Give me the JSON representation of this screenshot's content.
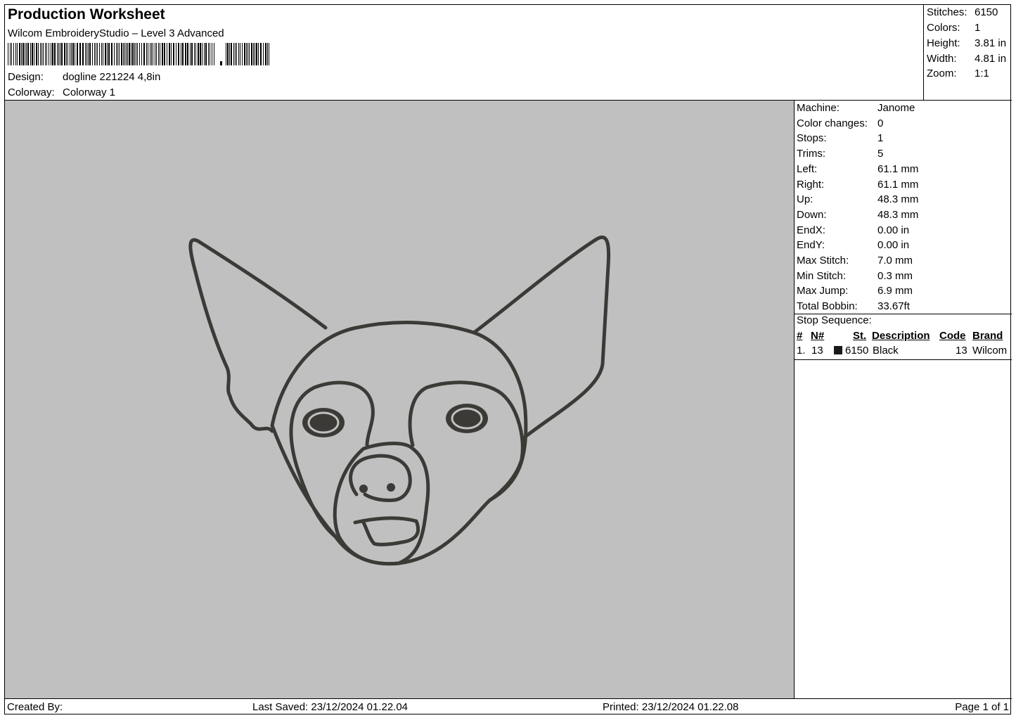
{
  "header": {
    "title": "Production Worksheet",
    "software": "Wilcom EmbroideryStudio – Level 3 Advanced",
    "design_label": "Design:",
    "design_value": "dogline 221224 4,8in",
    "colorway_label": "Colorway:",
    "colorway_value": "Colorway 1"
  },
  "summary": {
    "stitches_label": "Stitches:",
    "stitches": "6150",
    "colors_label": "Colors:",
    "colors": "1",
    "height_label": "Height:",
    "height": "3.81 in",
    "width_label": "Width:",
    "width": "4.81 in",
    "zoom_label": "Zoom:",
    "zoom": "1:1"
  },
  "machine_info": [
    {
      "label": "Machine:",
      "value": "Janome"
    },
    {
      "label": "Color changes:",
      "value": "0"
    },
    {
      "label": "Stops:",
      "value": "1"
    },
    {
      "label": "Trims:",
      "value": "5"
    },
    {
      "label": "Left:",
      "value": "61.1 mm"
    },
    {
      "label": "Right:",
      "value": "61.1 mm"
    },
    {
      "label": "Up:",
      "value": "48.3 mm"
    },
    {
      "label": "Down:",
      "value": "48.3 mm"
    },
    {
      "label": "EndX:",
      "value": "0.00 in"
    },
    {
      "label": "EndY:",
      "value": "0.00 in"
    },
    {
      "label": "Max Stitch:",
      "value": "7.0 mm"
    },
    {
      "label": "Min Stitch:",
      "value": "0.3 mm"
    },
    {
      "label": "Max Jump:",
      "value": "6.9 mm"
    },
    {
      "label": "Total Bobbin:",
      "value": "33.67ft"
    }
  ],
  "stop_sequence": {
    "title": "Stop Sequence:",
    "headers": {
      "num": "#",
      "n": "N#",
      "st": "St.",
      "description": "Description",
      "code": "Code",
      "brand": "Brand"
    },
    "rows": [
      {
        "num": "1.",
        "n": "13",
        "st": "6150",
        "description": "Black",
        "code": "13",
        "brand": "Wilcom",
        "color": "#1a1a1a"
      }
    ]
  },
  "footer": {
    "created_by": "Created By:",
    "last_saved": "Last Saved: 23/12/2024 01.22.04",
    "printed": "Printed: 23/12/2024 01.22.08",
    "page": "Page 1 of 1"
  },
  "design_preview": {
    "background_color": "#c0c0c0",
    "thread_color": "#3b3a36",
    "subject": "chihuahua-face-outline"
  }
}
